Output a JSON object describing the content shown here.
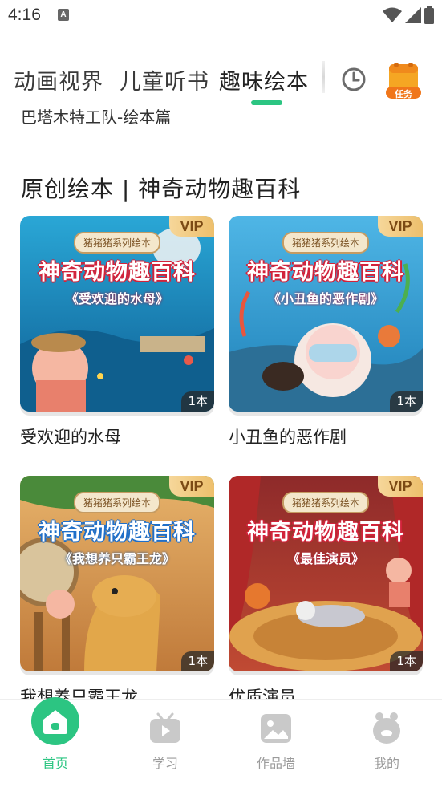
{
  "status_bar": {
    "time": "4:16",
    "notification_glyph": "A",
    "icons": [
      "wifi-icon",
      "signal-icon",
      "battery-icon"
    ]
  },
  "tabs": [
    {
      "label": "动画视界",
      "active": false
    },
    {
      "label": "儿童听书",
      "active": false
    },
    {
      "label": "趣味绘本",
      "active": true
    }
  ],
  "header_actions": {
    "history_icon": "clock-icon",
    "task_label": "任务"
  },
  "content": {
    "previous_section_title": "巴塔木特工队-绘本篇",
    "section_title": "原创绘本 | 神奇动物趣百科",
    "books": [
      {
        "title": "受欢迎的水母",
        "cover_series": "猪猪猪系列绘本",
        "cover_title": "神奇动物趣百科",
        "cover_subtitle": "《受欢迎的水母》",
        "badge": "VIP",
        "count": "1本"
      },
      {
        "title": "小丑鱼的恶作剧",
        "cover_series": "猪猪猪系列绘本",
        "cover_title": "神奇动物趣百科",
        "cover_subtitle": "《小丑鱼的恶作剧》",
        "badge": "VIP",
        "count": "1本"
      },
      {
        "title": "我想养只霸王龙",
        "cover_series": "猪猪猪系列绘本",
        "cover_title": "神奇动物趣百科",
        "cover_subtitle": "《我想养只霸王龙》",
        "badge": "VIP",
        "count": "1本"
      },
      {
        "title": "优质演员",
        "cover_series": "猪猪猪系列绘本",
        "cover_title": "神奇动物趣百科",
        "cover_subtitle": "《最佳演员》",
        "badge": "VIP",
        "count": "1本"
      }
    ]
  },
  "bottom_nav": [
    {
      "label": "首页",
      "icon": "home-icon",
      "active": true
    },
    {
      "label": "学习",
      "icon": "tv-icon",
      "active": false
    },
    {
      "label": "作品墙",
      "icon": "picture-icon",
      "active": false
    },
    {
      "label": "我的",
      "icon": "profile-icon",
      "active": false
    }
  ],
  "colors": {
    "accent": "#2cc582",
    "vip_gold": "#edbf6c",
    "task_orange": "#f5a623"
  }
}
